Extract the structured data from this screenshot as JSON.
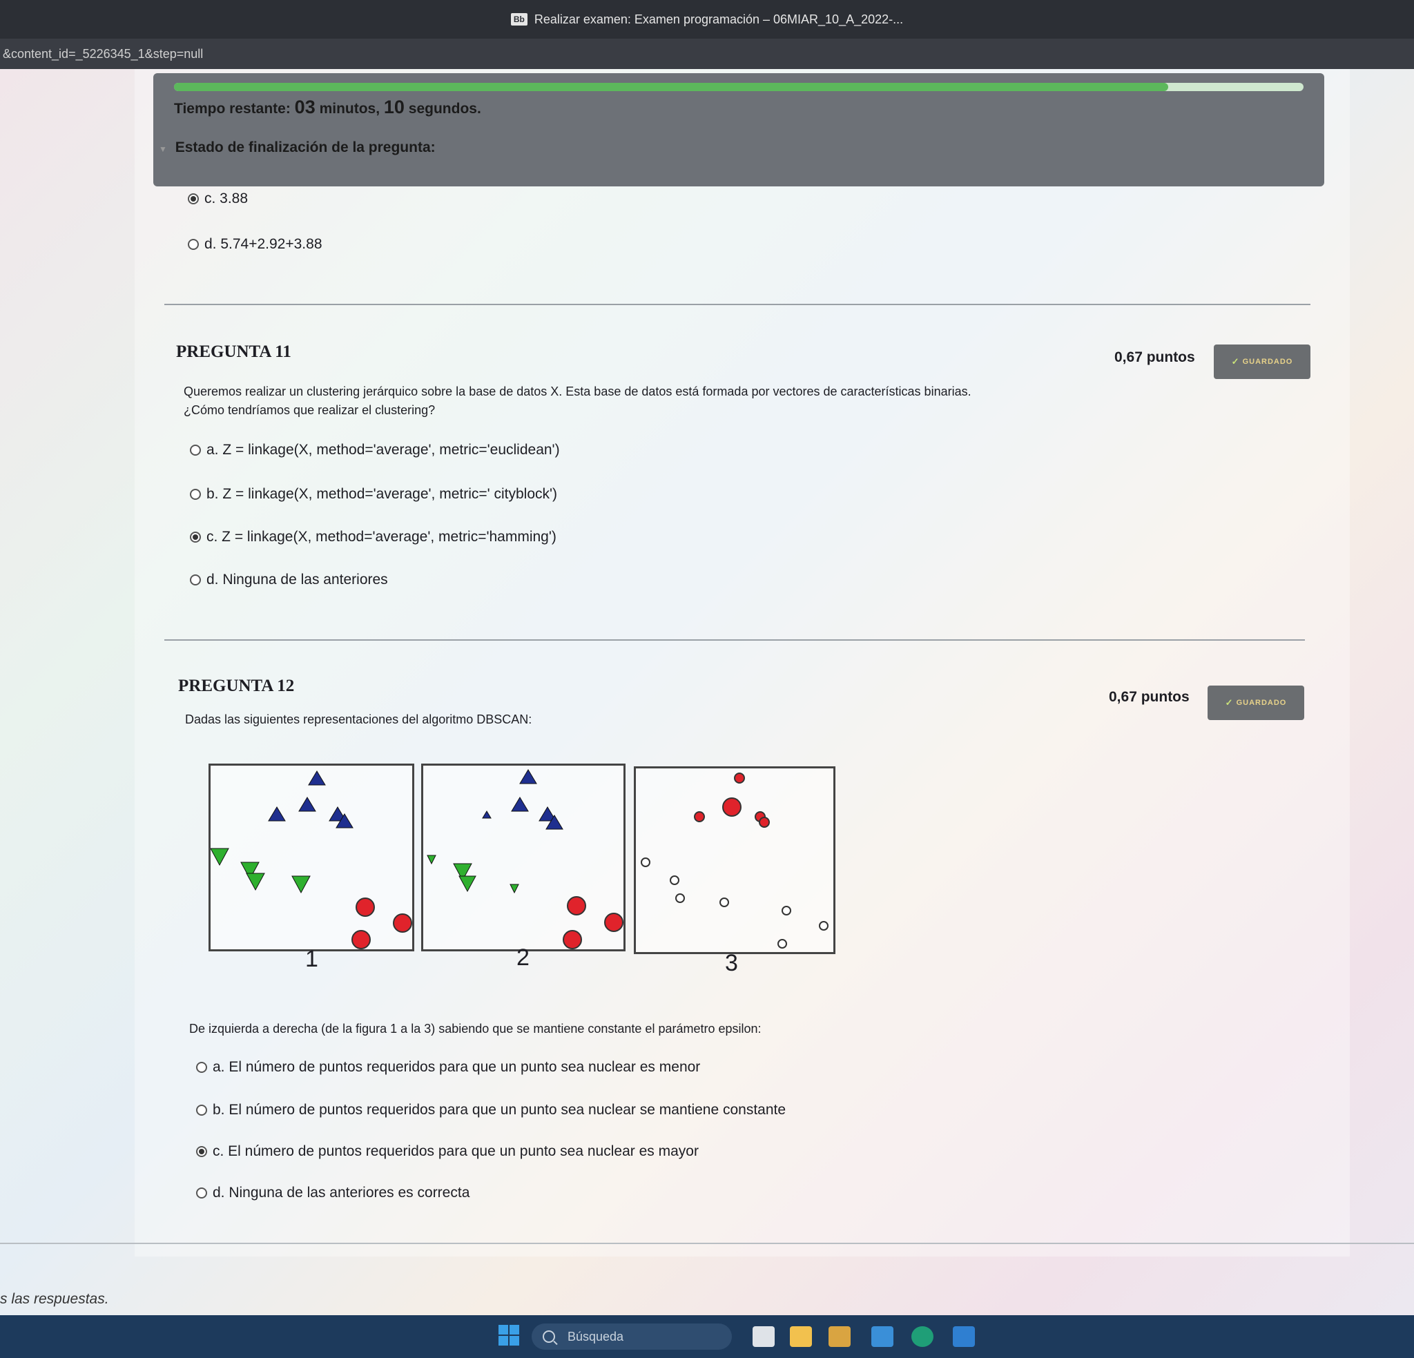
{
  "window": {
    "title": "Realizar examen: Examen programación – 06MIAR_10_A_2022-...",
    "url": "&content_id=_5226345_1&step=null"
  },
  "timer": {
    "prefix": "Tiempo restante:",
    "minutes": "03",
    "minutes_label": "minutos,",
    "seconds": "10",
    "seconds_label": "segundos."
  },
  "status": {
    "label": "Estado de finalización de la pregunta:"
  },
  "prev_question": {
    "options": [
      {
        "label": "c. 3.88",
        "selected": true
      },
      {
        "label": "d. 5.74+2.92+3.88",
        "selected": false
      }
    ]
  },
  "q11": {
    "title": "PREGUNTA 11",
    "points": "0,67 puntos",
    "badge": "GUARDADO",
    "text1": "Queremos realizar un clustering jerárquico sobre la base de datos X. Esta base de datos está formada por vectores de características binarias.",
    "text2": "¿Cómo tendríamos que realizar el clustering?",
    "options": [
      {
        "label": "a. Z = linkage(X, method='average', metric='euclidean')",
        "selected": false
      },
      {
        "label": "b. Z = linkage(X, method='average', metric=' cityblock')",
        "selected": false
      },
      {
        "label": "c. Z = linkage(X, method='average', metric='hamming')",
        "selected": true
      },
      {
        "label": "d. Ninguna de las anteriores",
        "selected": false
      }
    ]
  },
  "q12": {
    "title": "PREGUNTA 12",
    "points": "0,67 puntos",
    "badge": "GUARDADO",
    "text1": "Dadas las siguientes representaciones del algoritmo DBSCAN:",
    "figure_labels": [
      "1",
      "2",
      "3"
    ],
    "text2": "De izquierda a derecha (de la figura 1 a la 3) sabiendo que se mantiene constante el parámetro epsilon:",
    "options": [
      {
        "label": "a. El número de puntos requeridos para que un punto sea nuclear es menor",
        "selected": false
      },
      {
        "label": "b. El número de puntos requeridos para que un punto sea nuclear se mantiene constante",
        "selected": false
      },
      {
        "label": "c. El número de puntos requeridos para que un punto sea nuclear es mayor",
        "selected": true
      },
      {
        "label": "d. Ninguna de las anteriores es correcta",
        "selected": false
      }
    ]
  },
  "footer": {
    "text": "s las respuestas."
  },
  "taskbar": {
    "search_placeholder": "Búsqueda"
  },
  "colors": {
    "cluster_blue": "#1f2f8f",
    "cluster_green": "#2fb02f",
    "cluster_red": "#e0232b",
    "noise": "#ffffff"
  }
}
